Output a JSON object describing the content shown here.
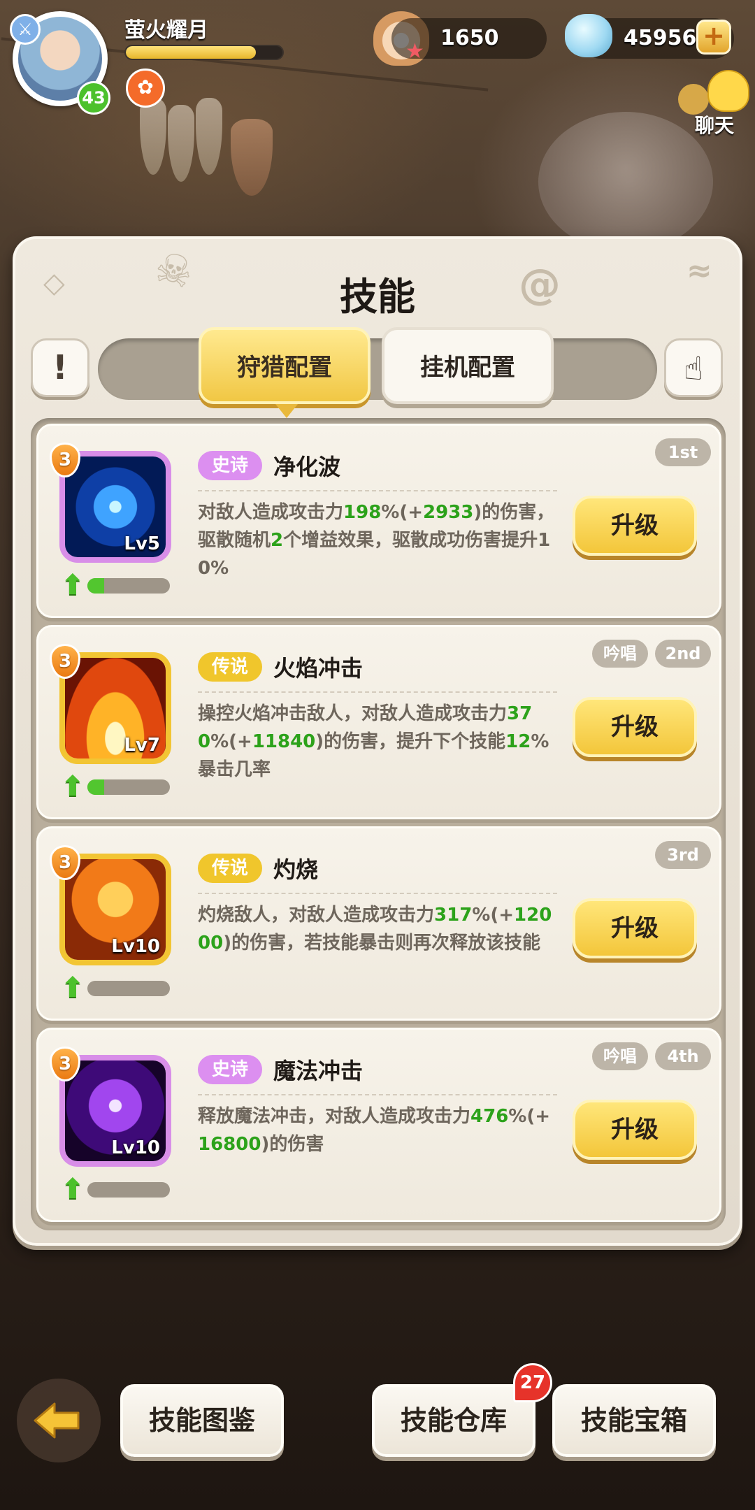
{
  "player": {
    "name": "萤火耀月",
    "level": "43",
    "xp_fraction": 0.83
  },
  "currency": {
    "pearls": "1650",
    "gems": "45956"
  },
  "chat": {
    "label": "聊天"
  },
  "panel": {
    "title": "技能"
  },
  "tabs": [
    {
      "label": "狩猎配置",
      "active": true
    },
    {
      "label": "挂机配置",
      "active": false
    }
  ],
  "skills": [
    {
      "rarity": "史诗",
      "name": "净化波",
      "level": "Lv5",
      "stars": "3",
      "rank": "1st",
      "chant": "",
      "progress": 0.2,
      "desc": [
        {
          "t": "对敌人造成攻击力"
        },
        {
          "t": "198",
          "g": 1
        },
        {
          "t": "%(+"
        },
        {
          "t": "2933",
          "g": 1
        },
        {
          "t": ")的伤害，驱散随机"
        },
        {
          "t": "2",
          "g": 1
        },
        {
          "t": "个增益效果，驱散成功伤害提升10%"
        }
      ],
      "button": "升级"
    },
    {
      "rarity": "传说",
      "name": "火焰冲击",
      "level": "Lv7",
      "stars": "3",
      "rank": "2nd",
      "chant": "吟唱",
      "progress": 0.2,
      "desc": [
        {
          "t": "操控火焰冲击敌人，对敌人造成攻击力"
        },
        {
          "t": "370",
          "g": 1
        },
        {
          "t": "%(+"
        },
        {
          "t": "11840",
          "g": 1
        },
        {
          "t": ")的伤害，提升下个技能"
        },
        {
          "t": "12",
          "g": 1
        },
        {
          "t": "%暴击几率"
        }
      ],
      "button": "升级"
    },
    {
      "rarity": "传说",
      "name": "灼烧",
      "level": "Lv10",
      "stars": "3",
      "rank": "3rd",
      "chant": "",
      "progress": 0.0,
      "desc": [
        {
          "t": "灼烧敌人，对敌人造成攻击力"
        },
        {
          "t": "317",
          "g": 1
        },
        {
          "t": "%(+"
        },
        {
          "t": "12000",
          "g": 1
        },
        {
          "t": ")的伤害，若技能暴击则再次释放该技能"
        }
      ],
      "button": "升级"
    },
    {
      "rarity": "史诗",
      "name": "魔法冲击",
      "level": "Lv10",
      "stars": "3",
      "rank": "4th",
      "chant": "吟唱",
      "progress": 0.0,
      "desc": [
        {
          "t": "释放魔法冲击，对敌人造成攻击力"
        },
        {
          "t": "476",
          "g": 1
        },
        {
          "t": "%(+"
        },
        {
          "t": "16800",
          "g": 1
        },
        {
          "t": ")的伤害"
        }
      ],
      "button": "升级"
    }
  ],
  "bottom": {
    "codex": "技能图鉴",
    "storage": "技能仓库",
    "chest": "技能宝箱",
    "storage_badge": "27"
  },
  "icons": {
    "info": "exclamation-icon",
    "hand": "pointer-hand-icon",
    "back": "back-arrow-icon",
    "plus": "plus-icon"
  }
}
